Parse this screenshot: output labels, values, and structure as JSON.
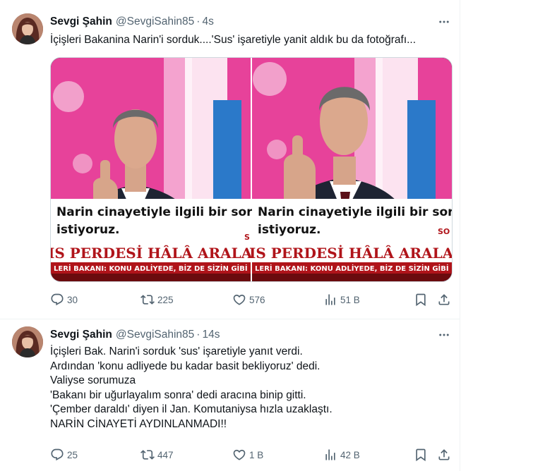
{
  "tweets": [
    {
      "display_name": "Sevgi Şahin",
      "handle": "@SevgiSahin85",
      "separator": "·",
      "time": "4s",
      "text_lines": [
        "İçişleri Bakanina Narin'i sorduk....'Sus' işaretiyle yanit aldık bu da fotoğrafı..."
      ],
      "media": {
        "caption_line1": "Narin cinayetiyle ilgili bir soru",
        "caption_line2": "istiyoruz.",
        "banner": "IS PERDESİ HÂLÂ ARALANAN",
        "ticker": "LERİ BAKANI: KONU ADLİYEDE, BİZ DE SİZİN GİBİ BEKLİY",
        "caption_line1_b": "Narin cinayetiyle ilgili bir soru",
        "caption_line2_b": "istiyoruz.",
        "banner_b": "IS PERDESİ HÂLÂ ARALANAN",
        "ticker_b": "LERİ BAKANI: KONU ADLİYEDE, BİZ DE SİZİN GİBİ B",
        "corner_a": "S",
        "corner_b": "SO"
      },
      "stats": {
        "replies": "30",
        "retweets": "225",
        "likes": "576",
        "views": "51 B"
      }
    },
    {
      "display_name": "Sevgi Şahin",
      "handle": "@SevgiSahin85",
      "separator": "·",
      "time": "14s",
      "text_lines": [
        "İçişleri Bak. Narin'i sorduk  'sus' işaretiyle yanıt verdi.",
        "Ardından 'konu adliyede bu kadar basit bekliyoruz' dedi.",
        "Valiyse sorumuza",
        "'Bakanı bir uğurlayalım sonra' dedi aracına binip gitti.",
        "'Çember daraldı' diyen il Jan. Komutaniysa hızla uzaklaştı.",
        "NARİN CİNAYETİ AYDINLANMADI!!"
      ],
      "stats": {
        "replies": "25",
        "retweets": "447",
        "likes": "1 B",
        "views": "42 B"
      }
    }
  ],
  "icons": {
    "more": "more-horizontal-icon",
    "reply": "reply-icon",
    "retweet": "retweet-icon",
    "like": "heart-icon",
    "views": "analytics-icon",
    "bookmark": "bookmark-icon",
    "share": "share-icon"
  },
  "colors": {
    "text": "#0f1419",
    "secondary": "#536471",
    "border": "#eff3f4",
    "media_pink": "#e7429a",
    "caption_bg": "#ffffff",
    "banner_red": "#b0141a"
  }
}
